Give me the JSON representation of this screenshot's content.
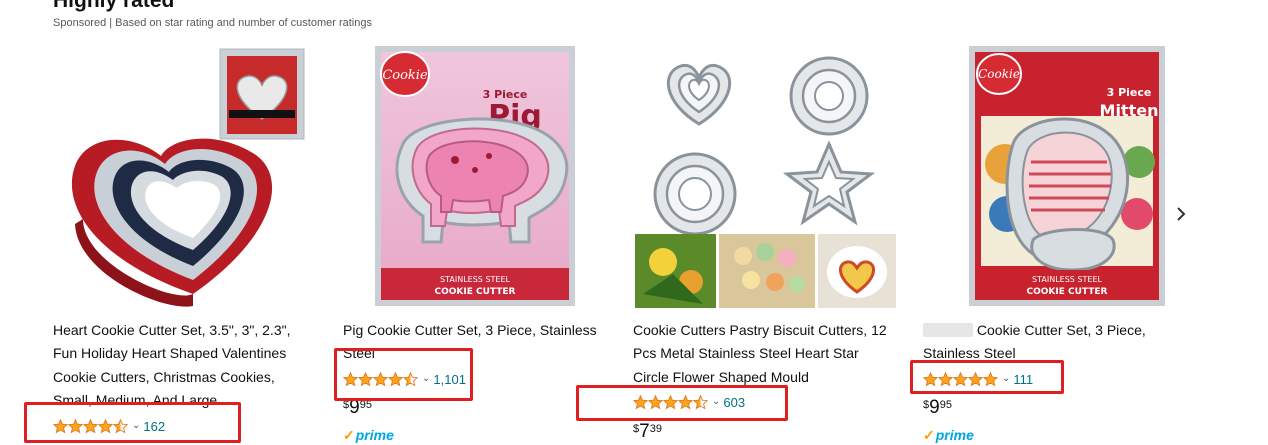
{
  "section": {
    "title": "Highly rated",
    "subtitle": "Sponsored | Based on star rating and number of customer ratings"
  },
  "products": [
    {
      "title": "Heart Cookie Cutter Set, 3.5\", 3\", 2.3\", Fun Holiday Heart Shaped Valentines Cookie Cutters, Christmas Cookies, Small, Medium, And Large",
      "rating": 4.5,
      "rating_count": "162",
      "price": null,
      "prime": false
    },
    {
      "title": "Pig Cookie Cutter Set, 3 Piece, Stainless Steel",
      "rating": 4.5,
      "rating_count": "1,101",
      "price": {
        "symbol": "$",
        "whole": "9",
        "fraction": "95"
      },
      "prime": true,
      "prime_label": "prime",
      "package_text": {
        "brand": "Cookie",
        "big": "Pig",
        "small": "3 Piece",
        "bottom1": "STAINLESS STEEL",
        "bottom2": "COOKIE CUTTER"
      }
    },
    {
      "title": "Cookie Cutters Pastry Biscuit Cutters, 12 Pcs Metal Stainless Steel Heart Star Circle Flower Shaped Mould",
      "rating": 4.5,
      "rating_count": "603",
      "price": {
        "symbol": "$",
        "whole": "7",
        "fraction": "39"
      },
      "prime": false
    },
    {
      "title": "Cookie Cutter Set, 3 Piece, Stainless Steel",
      "rating": 5,
      "rating_count": "111",
      "price": {
        "symbol": "$",
        "whole": "9",
        "fraction": "95"
      },
      "prime": true,
      "prime_label": "prime",
      "package_text": {
        "brand": "Cookie",
        "big": "Mitten",
        "small": "3 Piece",
        "bottom1": "STAINLESS STEEL",
        "bottom2": "COOKIE CUTTER"
      }
    }
  ],
  "colors": {
    "star": "#ffa41c",
    "link": "#007185",
    "highlight": "#e02020",
    "prime_blue": "#00a8e1",
    "prime_orange": "#ff9900"
  },
  "icons": {
    "next": "chevron-right-icon",
    "rating_dropdown": "chevron-down-icon"
  }
}
